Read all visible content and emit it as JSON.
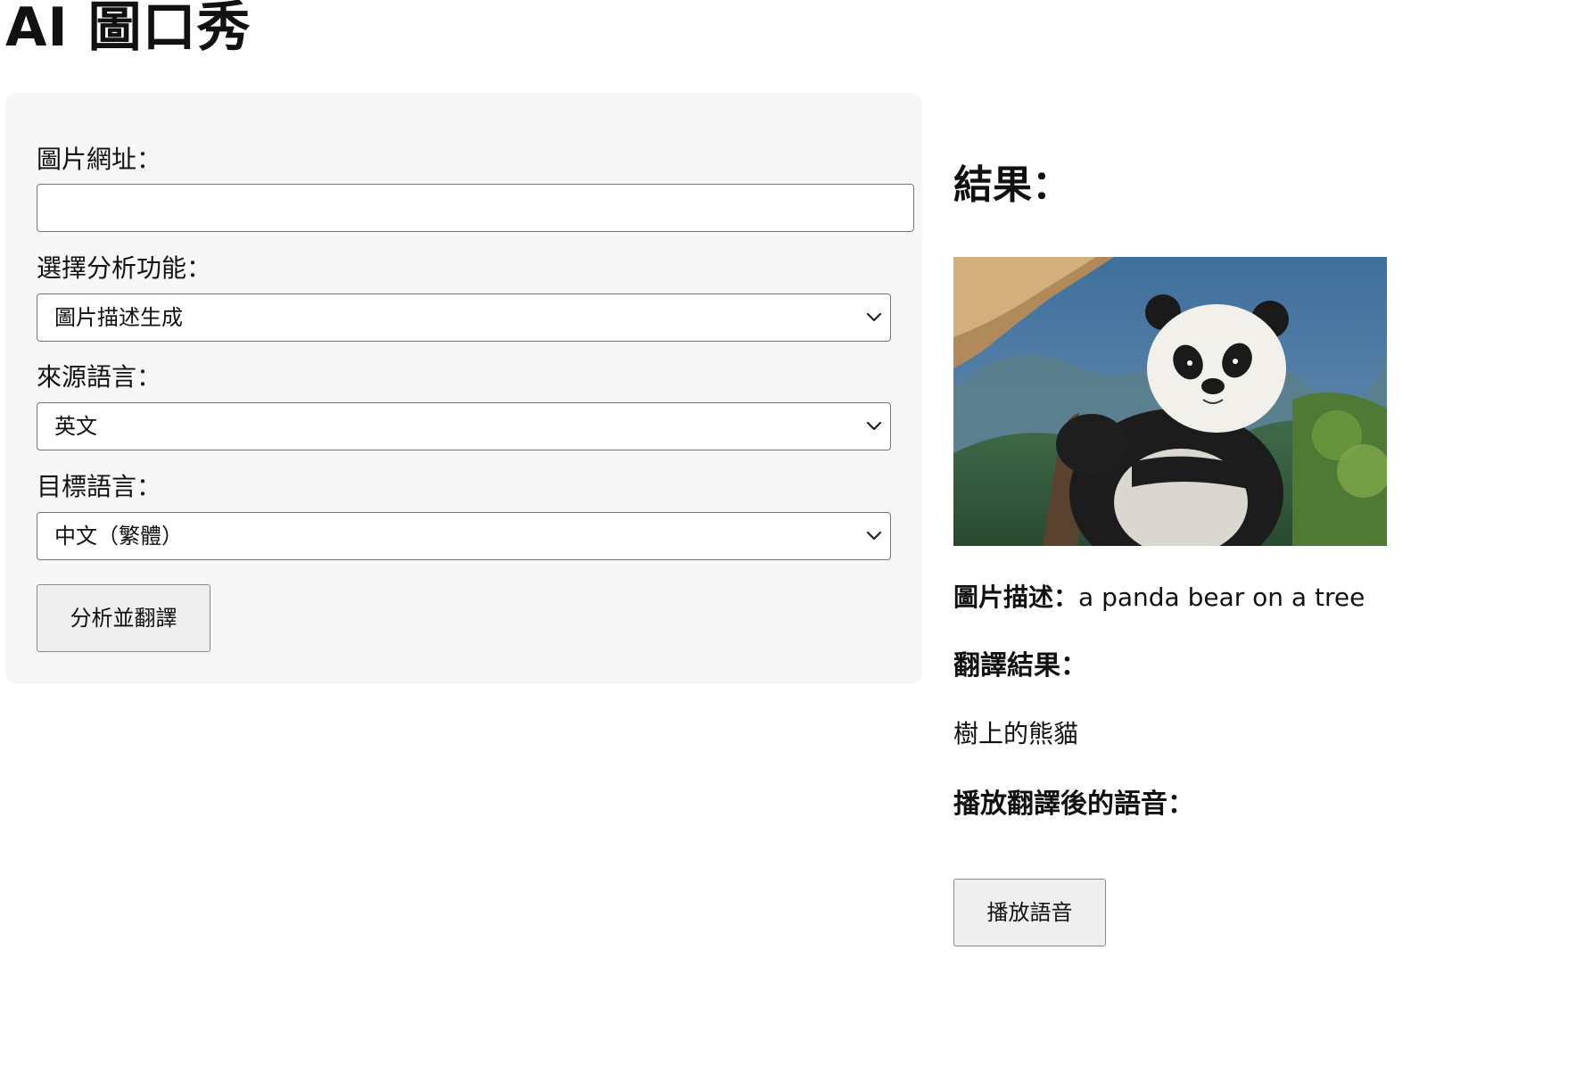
{
  "app": {
    "title": "AI 圖口秀"
  },
  "form": {
    "image_url_label": "圖片網址：",
    "image_url_value": "",
    "function_label": "選擇分析功能：",
    "function_selected": "圖片描述生成",
    "source_lang_label": "來源語言：",
    "source_lang_selected": "英文",
    "target_lang_label": "目標語言：",
    "target_lang_selected": "中文（繁體）",
    "submit_label": "分析並翻譯"
  },
  "result": {
    "heading": "結果：",
    "image_icon": "panda-photo",
    "description_label": "圖片描述：",
    "description_text": "a panda bear on a tree",
    "translation_heading": "翻譯結果：",
    "translation_text": "樹上的熊貓",
    "audio_heading": "播放翻譯後的語音：",
    "play_label": "播放語音"
  },
  "colors": {
    "panel_background": "#f7f7f7",
    "button_background": "#efefef",
    "border": "#777777"
  }
}
